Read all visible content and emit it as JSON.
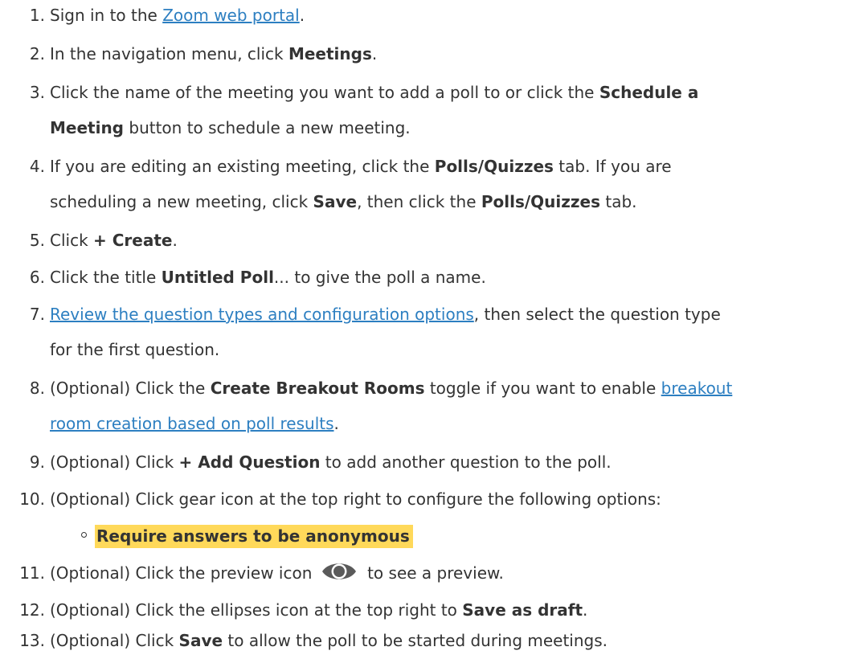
{
  "steps": [
    {
      "num": "1.",
      "pre": "Sign in to the ",
      "link": "Zoom web portal",
      "post": "."
    },
    {
      "num": "2.",
      "pre": "In the navigation menu, click ",
      "bold": "Meetings",
      "post": "."
    },
    {
      "num": "3.",
      "line1_pre": "Click the name of the meeting you want to add a poll to or click the ",
      "line1_bold": "Schedule a",
      "line2_bold": "Meeting",
      "line2_post": " button to schedule a new meeting."
    },
    {
      "num": "4.",
      "line1_pre": "If you are editing an existing meeting, click the ",
      "line1_bold": "Polls/Quizzes",
      "line1_post": " tab. If you are",
      "line2_pre": "scheduling a new meeting, click ",
      "line2_bold1": "Save",
      "line2_mid": ", then click the ",
      "line2_bold2": "Polls/Quizzes",
      "line2_post": " tab."
    },
    {
      "num": "5.",
      "pre": "Click ",
      "bold": "+ Create",
      "post": "."
    },
    {
      "num": "6.",
      "pre": "Click the title ",
      "bold": "Untitled Poll",
      "post": "... to give the poll a name."
    },
    {
      "num": "7.",
      "line1_link": "Review the question types and configuration options",
      "line1_post": ", then select the question type",
      "line2": "for the first question."
    },
    {
      "num": "8.",
      "line1_pre": "(Optional) Click the ",
      "line1_bold": "Create Breakout Rooms",
      "line1_mid": " toggle if you want to enable ",
      "line1_link": "breakout",
      "line2_link": "room creation based on poll results",
      "line2_post": "."
    },
    {
      "num": "9.",
      "pre": "(Optional) Click ",
      "bold": "+ Add Question",
      "post": " to add another question to the poll."
    },
    {
      "num": "10.",
      "pre": "(Optional) Click gear icon at the top right to configure the following options:"
    },
    {
      "num": "11.",
      "pre": "(Optional) Click the preview icon ",
      "post": " to see a preview."
    },
    {
      "num": "12.",
      "pre": "(Optional) Click the ellipses icon at the top right to ",
      "bold": "Save as draft",
      "post": "."
    },
    {
      "num": "13.",
      "pre": "(Optional) Click ",
      "bold": "Save",
      "post": " to allow the poll to be started during meetings."
    }
  ],
  "sub_option": "Require answers to be anonymous",
  "icons": {
    "preview": "eye-icon",
    "bullet": "circle-bullet-icon"
  },
  "colors": {
    "text": "#333333",
    "link": "#2d7fc1",
    "highlight": "#ffd95a",
    "icon": "#5a5a5a"
  }
}
